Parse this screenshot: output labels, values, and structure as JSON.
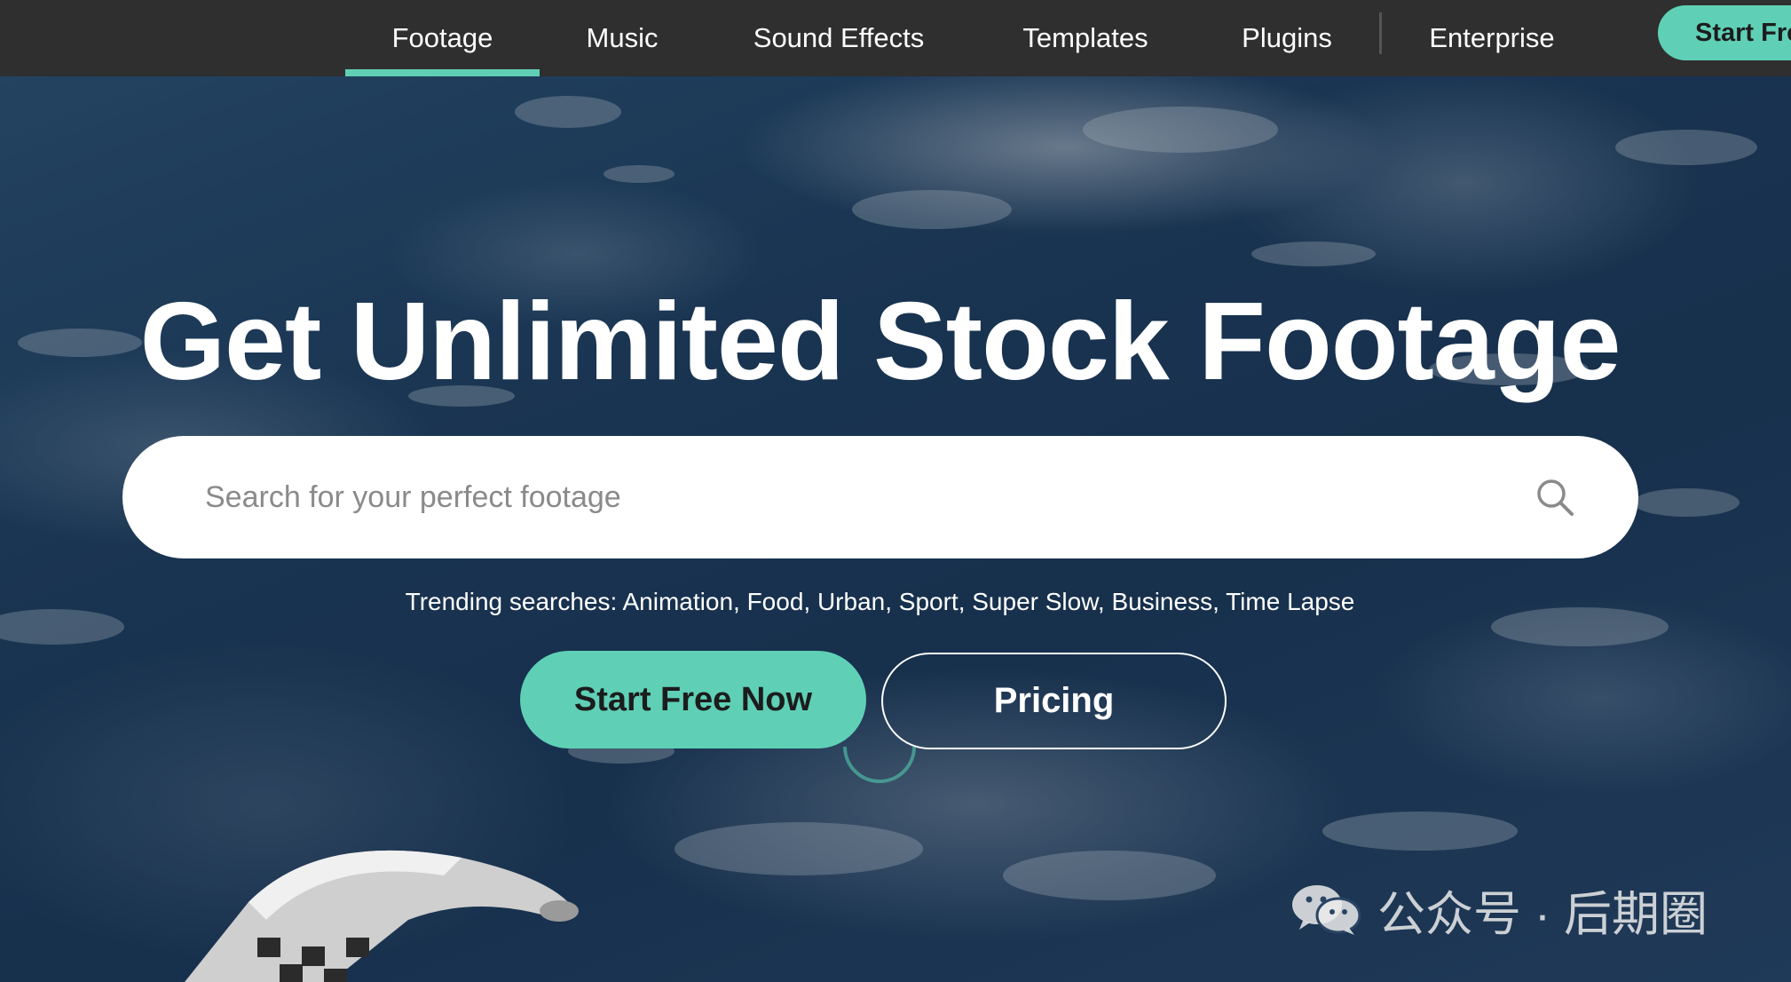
{
  "nav": {
    "tabs": [
      {
        "label": "Footage",
        "active": true
      },
      {
        "label": "Music",
        "active": false
      },
      {
        "label": "Sound Effects",
        "active": false
      },
      {
        "label": "Templates",
        "active": false
      },
      {
        "label": "Plugins",
        "active": false
      },
      {
        "label": "Enterprise",
        "active": false
      }
    ],
    "start_button": "Start Fre"
  },
  "hero": {
    "title": "Get Unlimited Stock Footage",
    "search": {
      "placeholder": "Search for your perfect footage",
      "value": "",
      "icon": "search-icon"
    },
    "trending": "Trending searches: Animation, Food, Urban, Sport, Super Slow, Business, Time Lapse",
    "cta_start": "Start Free Now",
    "cta_pricing": "Pricing"
  },
  "watermark": {
    "icon": "wechat-icon",
    "text": "公众号 · 后期圈"
  },
  "colors": {
    "accent": "#5fd0b6",
    "nav_background": "#2f2f2f",
    "text_light": "#ffffff"
  }
}
